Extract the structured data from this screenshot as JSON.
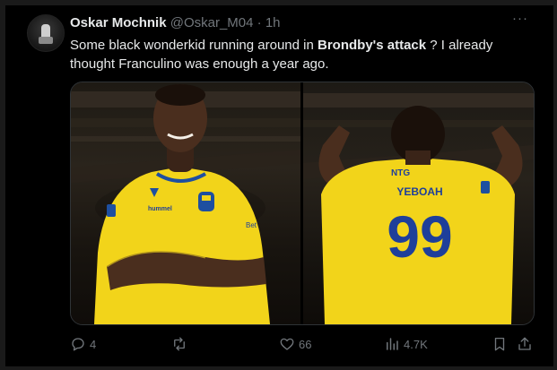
{
  "tweet": {
    "author_name": "Oskar Mochnik",
    "author_handle": "@Oskar_M04",
    "separator": "·",
    "time": "1h",
    "more_label": "···",
    "text_part1": "Some black wonderkid running around in ",
    "text_bold": "Brondby's attack",
    "text_part2": " ? I already thought Franculino was enough a year ago."
  },
  "media": {
    "photo1": {
      "jersey_sponsor": "hummel",
      "crest_color": "#1e4fa0",
      "jersey_color": "#f2d41a"
    },
    "photo2": {
      "jersey_sponsor": "NTG",
      "player_name": "YEBOAH",
      "number": "99",
      "jersey_color": "#f2d41a",
      "number_color": "#1e3f9a"
    }
  },
  "actions": {
    "replies": "4",
    "reposts": "",
    "likes": "66",
    "views": "4.7K"
  },
  "colors": {
    "background": "#000000",
    "text": "#e7e9ea",
    "muted": "#71767b",
    "border": "#2f3336"
  }
}
